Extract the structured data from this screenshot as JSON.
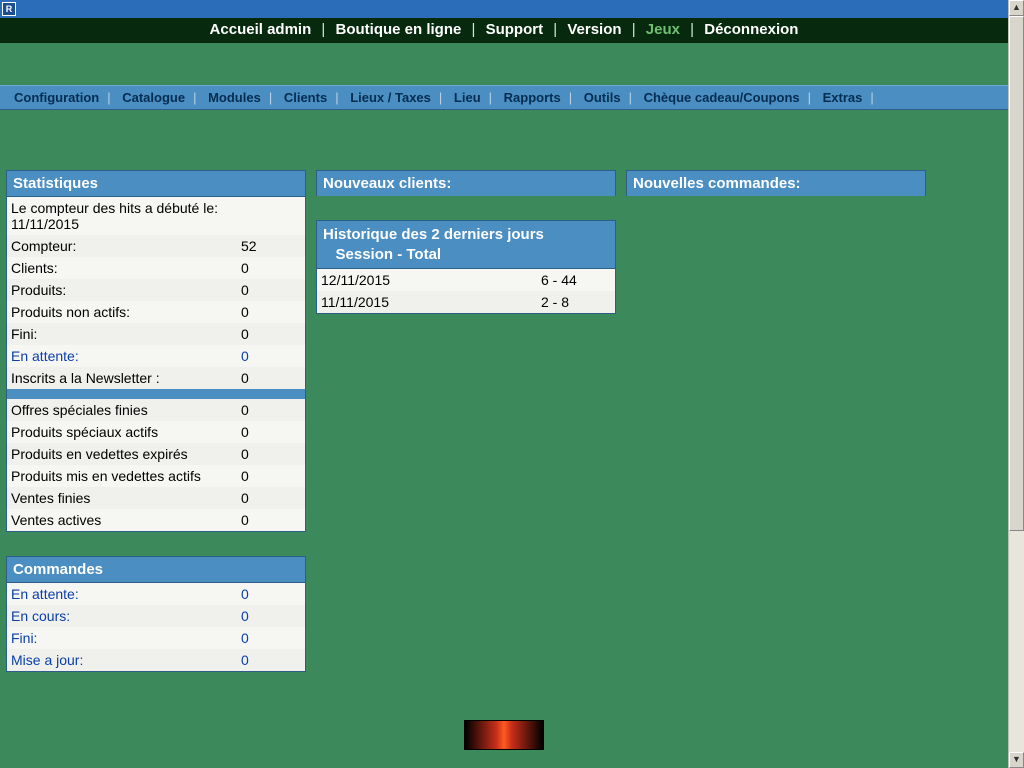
{
  "titlebar": {
    "icon_letter": "R"
  },
  "topnav": {
    "items": [
      {
        "label": "Accueil admin",
        "active": false
      },
      {
        "label": "Boutique en ligne",
        "active": false
      },
      {
        "label": "Support",
        "active": false
      },
      {
        "label": "Version",
        "active": false
      },
      {
        "label": "Jeux",
        "active": true
      },
      {
        "label": "Déconnexion",
        "active": false
      }
    ]
  },
  "subnav": {
    "items": [
      "Configuration",
      "Catalogue",
      "Modules",
      "Clients",
      "Lieux / Taxes",
      "Lieu",
      "Rapports",
      "Outils",
      "Chèque cadeau/Coupons",
      "Extras"
    ]
  },
  "stats": {
    "title": "Statistiques",
    "counter_started": "Le compteur des hits a débuté le:\n11/11/2015",
    "rows": [
      {
        "label": "Compteur:",
        "value": "52",
        "link": false
      },
      {
        "label": "Clients:",
        "value": "0",
        "link": false
      },
      {
        "label": "Produits:",
        "value": "0",
        "link": false
      },
      {
        "label": "Produits non actifs:",
        "value": "0",
        "link": false
      },
      {
        "label": "Fini:",
        "value": "0",
        "link": false
      },
      {
        "label": "En attente:",
        "value": "0",
        "link": true
      },
      {
        "label": "Inscrits a la Newsletter :",
        "value": "0",
        "link": false
      }
    ],
    "rows2": [
      {
        "label": "Offres spéciales finies",
        "value": "0",
        "link": false
      },
      {
        "label": "Produits spéciaux actifs",
        "value": "0",
        "link": false
      },
      {
        "label": "Produits en vedettes expirés",
        "value": "0",
        "link": false
      },
      {
        "label": "Produits mis en vedettes actifs",
        "value": "0",
        "link": false
      },
      {
        "label": "Ventes finies",
        "value": "0",
        "link": false
      },
      {
        "label": "Ventes actives",
        "value": "0",
        "link": false
      }
    ]
  },
  "orders": {
    "title": "Commandes",
    "rows": [
      {
        "label": "En attente:",
        "value": "0",
        "link": true
      },
      {
        "label": "En cours:",
        "value": "0",
        "link": true
      },
      {
        "label": "Fini:",
        "value": "0",
        "link": true
      },
      {
        "label": "Mise a jour:",
        "value": "0",
        "link": true
      }
    ]
  },
  "new_customers": {
    "title": "Nouveaux clients:",
    "history_header_1": "Historique des 2 derniers jours",
    "history_header_2": "Session - Total",
    "rows": [
      {
        "date": "12/11/2015",
        "value": "6 - 44"
      },
      {
        "date": "11/11/2015",
        "value": "2 - 8"
      }
    ]
  },
  "new_orders": {
    "title": "Nouvelles commandes:"
  }
}
